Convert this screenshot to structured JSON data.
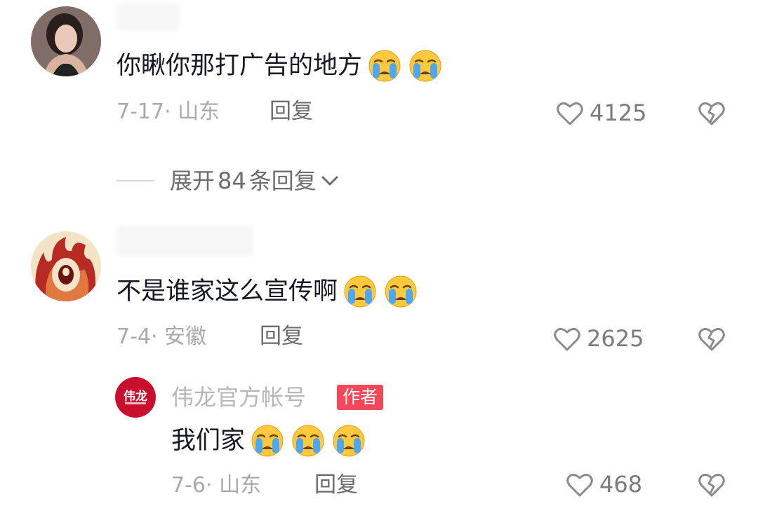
{
  "comments": [
    {
      "text": "你瞅你那打广告的地方",
      "date": "7-17",
      "location": "山东",
      "reply_label": "回复",
      "likes": "4125",
      "expand": {
        "prefix": "展开",
        "count": "84",
        "suffix": "条回复"
      }
    },
    {
      "text": "不是谁家这么宣传啊",
      "date": "7-4",
      "location": "安徽",
      "reply_label": "回复",
      "likes": "2625",
      "reply": {
        "author": "伟龙官方帐号",
        "badge": "作者",
        "avatar_logo": "伟龙",
        "text": "我们家",
        "date": "7-6",
        "location": "山东",
        "reply_label": "回复",
        "likes": "468"
      }
    }
  ],
  "colors": {
    "badge": "#f2485a",
    "logo": "#c8102e",
    "meta": "#a9a9ae"
  },
  "icons": [
    "crying-emoji-icon",
    "heart-outline-icon",
    "broken-heart-icon",
    "chevron-down-icon"
  ]
}
